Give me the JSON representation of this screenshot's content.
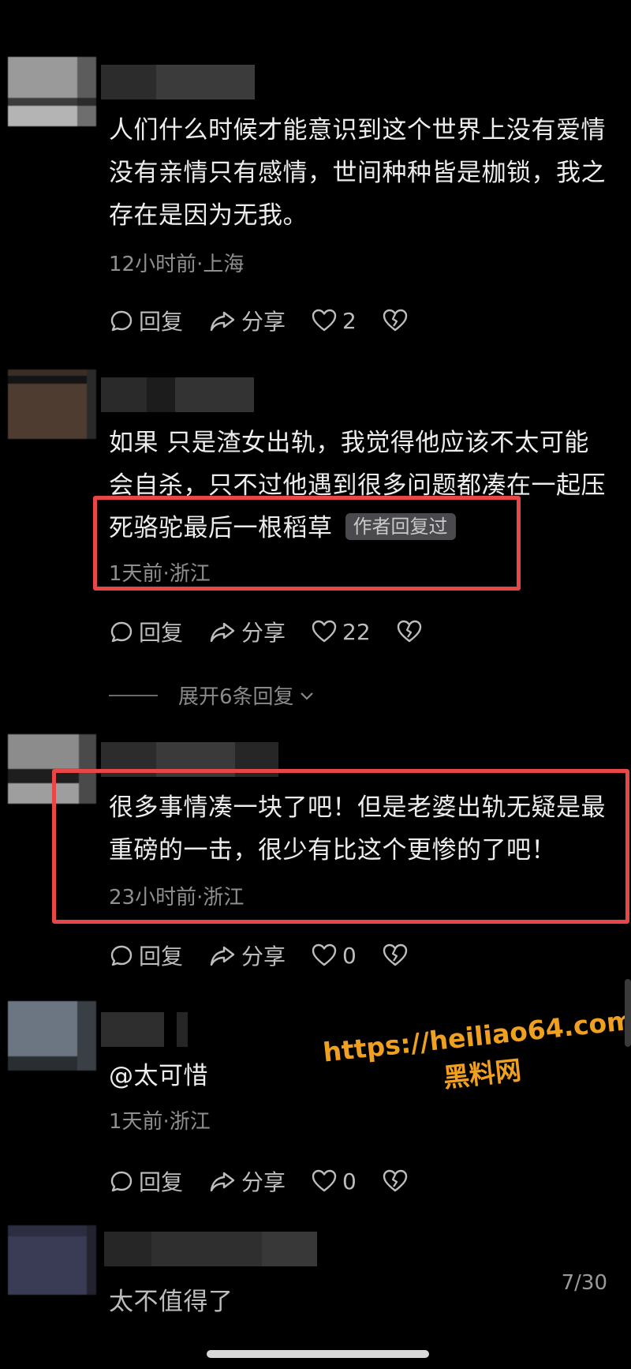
{
  "comments": [
    {
      "text": "人们什么时候才能意识到这个世界上没有爱情没有亲情只有感情，世间种种皆是枷锁，我之存在是因为无我。",
      "meta": "12小时前·上海",
      "reply_label": "回复",
      "share_label": "分享",
      "like_count": "2"
    },
    {
      "text": "如果 只是渣女出轨，我觉得他应该不太可能会自杀，只不过他遇到很多问题都凑在一起压死骆驼最后一根稻草",
      "author_tag": "作者回复过",
      "meta": "1天前·浙江",
      "reply_label": "回复",
      "share_label": "分享",
      "like_count": "22",
      "expand_label": "展开6条回复"
    },
    {
      "text": "很多事情凑一块了吧！但是老婆出轨无疑是最重磅的一击，很少有比这个更惨的了吧！",
      "meta": "23小时前·浙江",
      "reply_label": "回复",
      "share_label": "分享",
      "like_count": "0"
    },
    {
      "text": "@太可惜",
      "meta": "1天前·浙江",
      "reply_label": "回复",
      "share_label": "分享",
      "like_count": "0"
    },
    {
      "text": "太不值得了"
    }
  ],
  "watermark": {
    "url": "https://heiliao64.com",
    "name": "黑料网"
  },
  "page_counter": "7/30",
  "colors": {
    "background": "#000000",
    "highlight_border": "#e94747",
    "watermark": "#f0a020",
    "author_tag_bg": "#4a4a4e"
  }
}
